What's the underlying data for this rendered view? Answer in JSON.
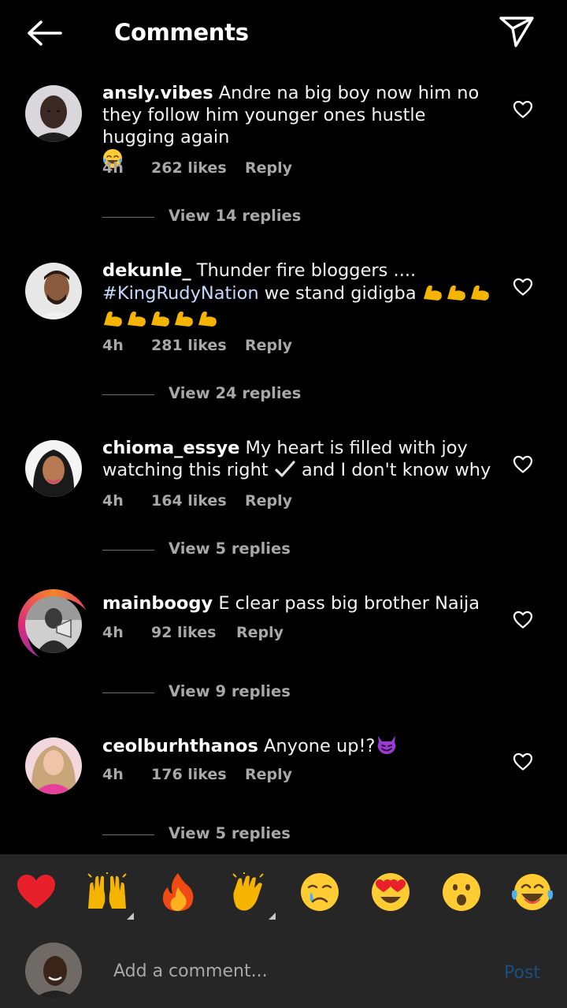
{
  "header": {
    "title": "Comments"
  },
  "comments": [
    {
      "username": "ansly.vibes",
      "text": "Andre na big boy now him no they follow him younger ones hustle hugging again",
      "time": "4h",
      "likes": "262 likes",
      "reply": "Reply",
      "view_replies": "View 14 replies"
    },
    {
      "username": "dekunle_",
      "text_before": "Thunder fire bloggers ....",
      "hashtag": "#KingRudyNation",
      "text_after": "we stand gidigba",
      "time": "4h",
      "likes": "281 likes",
      "reply": "Reply",
      "view_replies": "View 24 replies"
    },
    {
      "username": "chioma_essye",
      "text_before": "My heart is filled with joy watching this right",
      "text_after": "and I don't know why",
      "time": "4h",
      "likes": "164 likes",
      "reply": "Reply",
      "view_replies": "View 5 replies"
    },
    {
      "username": "mainboogy",
      "text": "E clear pass big brother Naija",
      "time": "4h",
      "likes": "92 likes",
      "reply": "Reply",
      "view_replies": "View 9 replies"
    },
    {
      "username": "ceolburhthanos",
      "text": "Anyone up!?",
      "time": "4h",
      "likes": "176 likes",
      "reply": "Reply",
      "view_replies": "View 5 replies"
    }
  ],
  "emoji_bar": [
    {
      "name": "red-heart"
    },
    {
      "name": "raising-hands",
      "has_variants": true
    },
    {
      "name": "fire"
    },
    {
      "name": "clapping-hands",
      "has_variants": true
    },
    {
      "name": "crying-face"
    },
    {
      "name": "heart-eyes"
    },
    {
      "name": "astonished-face"
    },
    {
      "name": "tears-of-joy"
    }
  ],
  "composer": {
    "placeholder": "Add a comment...",
    "post_label": "Post"
  },
  "colors": {
    "background": "#000000",
    "composer_background": "#262626",
    "secondary_text": "#a8a8a8",
    "hashtag": "#c8d8ff",
    "post_disabled": "#1b4f7d"
  }
}
